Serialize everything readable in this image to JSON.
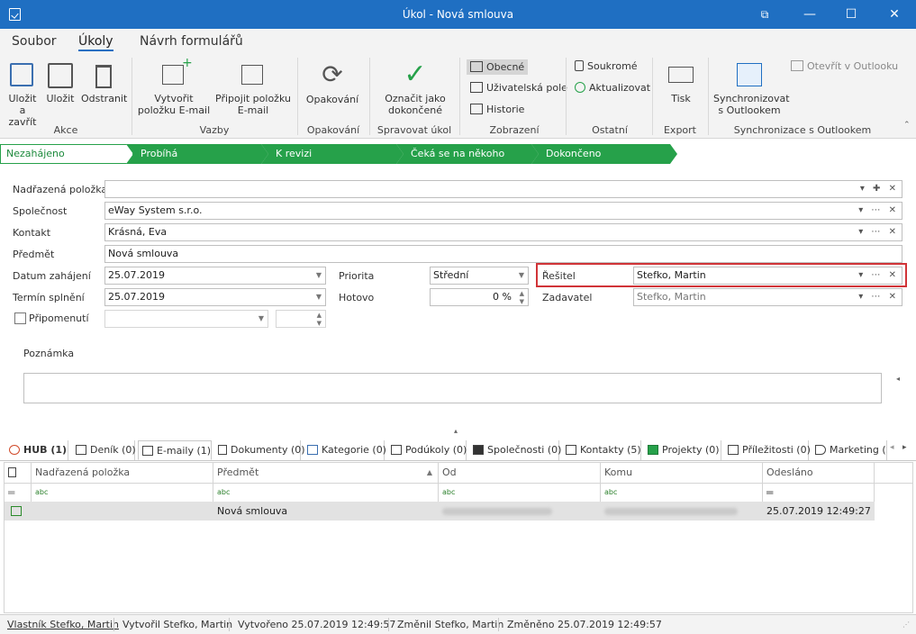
{
  "window": {
    "title": "Úkol - Nová smlouva",
    "buttons": {
      "restore": "⧉",
      "minimize": "—",
      "maximize": "☐",
      "close": "✕"
    }
  },
  "ribbon_tabs": [
    "Soubor",
    "Úkoly",
    "Návrh formulářů"
  ],
  "ribbon": {
    "akce": {
      "label": "Akce",
      "save_close": "Uložit a zavřít",
      "save": "Uložit",
      "delete": "Odstranit"
    },
    "vazby": {
      "label": "Vazby",
      "create_email": "Vytvořit položku E-mail",
      "attach_email": "Připojit položku E-mail"
    },
    "opakovani": {
      "label": "Opakování",
      "repeat": "Opakování"
    },
    "spravovat": {
      "label": "Spravovat úkol",
      "mark_done": "Označit jako dokončené"
    },
    "zobrazeni": {
      "label": "Zobrazení",
      "general": "Obecné",
      "user_fields": "Uživatelská pole",
      "history": "Historie"
    },
    "ostatni": {
      "label": "Ostatní",
      "private": "Soukromé",
      "update": "Aktualizovat"
    },
    "export": {
      "label": "Export",
      "print": "Tisk"
    },
    "outlook": {
      "label": "Synchronizace s Outlookem",
      "sync": "Synchronizovat s Outlookem",
      "open": "Otevřít v Outlooku"
    }
  },
  "stages": [
    "Nezahájeno",
    "Probíhá",
    "K revizi",
    "Čeká se na někoho dalšího",
    "Dokončeno"
  ],
  "form": {
    "parent_label": "Nadřazená položka",
    "parent_value": "",
    "company_label": "Společnost",
    "company_value": "eWay System s.r.o.",
    "contact_label": "Kontakt",
    "contact_value": "Krásná, Eva",
    "subject_label": "Předmět",
    "subject_value": "Nová smlouva",
    "start_label": "Datum zahájení",
    "start_value": "25.07.2019",
    "due_label": "Termín splnění",
    "due_value": "25.07.2019",
    "reminder_label": "Připomenutí",
    "priority_label": "Priorita",
    "priority_value": "Střední",
    "done_label": "Hotovo",
    "done_value": "0 %",
    "solver_label": "Řešitel",
    "solver_value": "Stefko, Martin",
    "assigner_label": "Zadavatel",
    "assigner_value": "Stefko, Martin",
    "note_label": "Poznámka"
  },
  "bottom_tabs": [
    "HUB (1)",
    "Deník (0)",
    "E-maily (1)",
    "Dokumenty (0)",
    "Kategorie (0)",
    "Podúkoly (0)",
    "Společnosti (0)",
    "Kontakty (5)",
    "Projekty (0)",
    "Příležitosti (0)",
    "Marketing ("
  ],
  "grid": {
    "headers": [
      "Nadřazená položka",
      "Předmět",
      "Od",
      "Komu",
      "Odesláno"
    ],
    "filter_icon": "abc",
    "row": {
      "parent": "",
      "subject": "Nová smlouva",
      "sent": "25.07.2019 12:49:27"
    }
  },
  "status_bar": {
    "owner": "Vlastník Stefko, Martin",
    "created_by": "Vytvořil Stefko, Martin",
    "created": "Vytvořeno 25.07.2019 12:49:57",
    "changed_by": "Změnil Stefko, Martin",
    "changed": "Změněno 25.07.2019 12:49:57"
  },
  "colors": {
    "titlebar": "#1f6fc2",
    "stage_green": "#26a14a",
    "highlight_border": "#d13438"
  }
}
